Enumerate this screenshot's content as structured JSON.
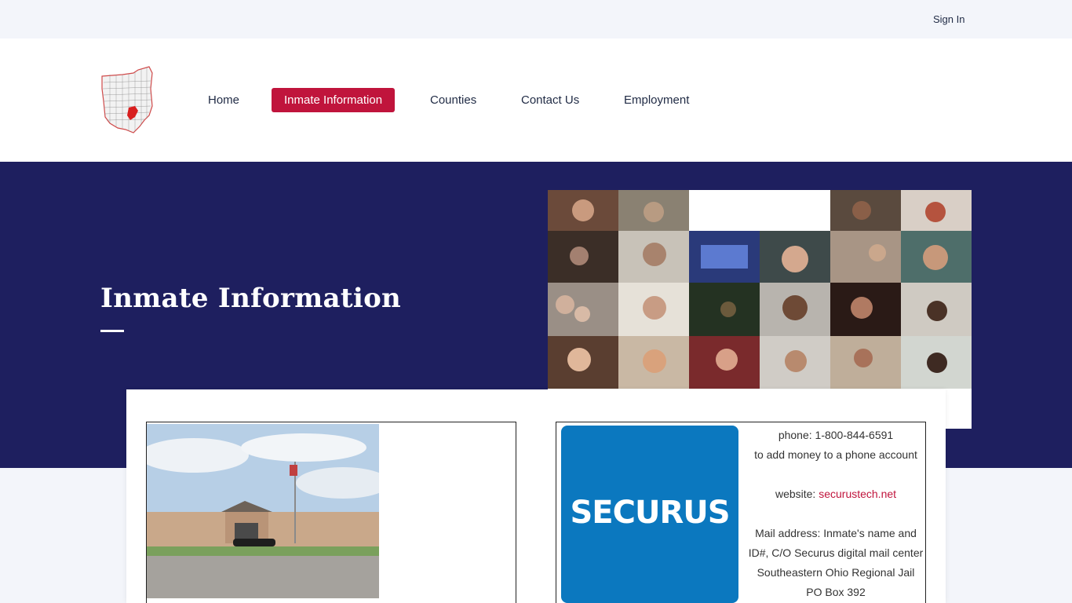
{
  "topbar": {
    "signin_label": "Sign In"
  },
  "nav": {
    "items": [
      {
        "label": "Home"
      },
      {
        "label": "Inmate Information"
      },
      {
        "label": "Counties"
      },
      {
        "label": "Contact Us"
      },
      {
        "label": "Employment"
      }
    ],
    "active_color": "#c0143c"
  },
  "hero": {
    "title": "Inmate Information",
    "background": "#1e1f5f"
  },
  "securus": {
    "logo_text": "SECURUS",
    "logo_color": "#0b78bf",
    "phone": "phone: 1-800-844-6591",
    "phone_note": "to add money to a phone account",
    "website_label": "website:",
    "website_link": "securustech.net",
    "mail_line1": "Mail address: Inmate's name and",
    "mail_line2": "ID#, C/O Securus digital mail center",
    "mail_line3": "Southeastern Ohio Regional Jail",
    "mail_line4": "PO Box 392"
  }
}
